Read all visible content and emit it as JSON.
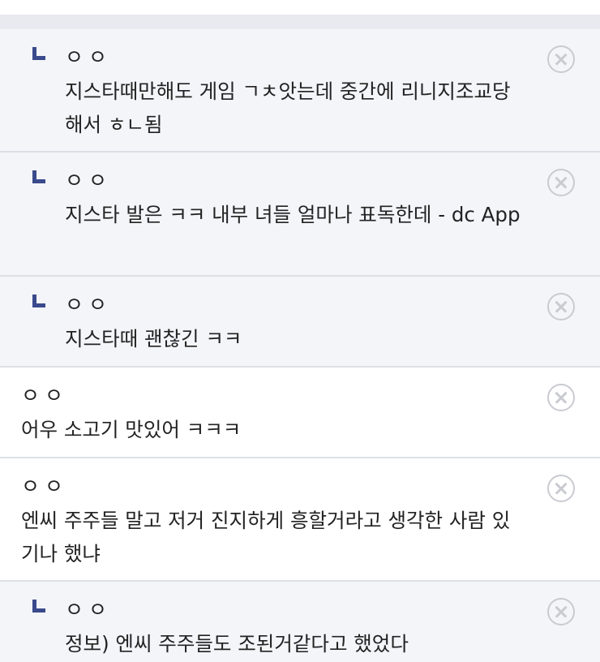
{
  "comments": [
    {
      "type": "reply",
      "author": "ㅇㅇ",
      "text": "지스타때만해도 게임 ㄱㅊ앗는데 중간에 리니지조교당해서 ㅎㄴ됨"
    },
    {
      "type": "reply",
      "author": "ㅇㅇ",
      "text": "지스타 발은 ㅋㅋ 내부 녀들 얼마나 표독한데 - dc App"
    },
    {
      "type": "reply",
      "author": "ㅇㅇ",
      "text": "지스타때 괜찮긴 ㅋㅋ"
    },
    {
      "type": "comment",
      "author": "ㅇㅇ",
      "text": "어우 소고기 맛있어 ㅋㅋㅋ"
    },
    {
      "type": "comment",
      "author": "ㅇㅇ",
      "text": "엔씨 주주들 말고 저거 진지하게 흥할거라고 생각한 사람 있기나 했냐"
    },
    {
      "type": "reply",
      "author": "ㅇㅇ",
      "text": "정보) 엔씨 주주들도 조된거같다고 했었다"
    }
  ],
  "icons": {
    "reply": "reply-arrow-icon",
    "delete": "delete-circle-x-icon"
  },
  "colors": {
    "reply_background": "#f4f5f9",
    "comment_background": "#ffffff",
    "reply_arrow": "#3b4a8c",
    "divider": "#dcdfe6",
    "delete_icon": "#c9cbd1"
  }
}
